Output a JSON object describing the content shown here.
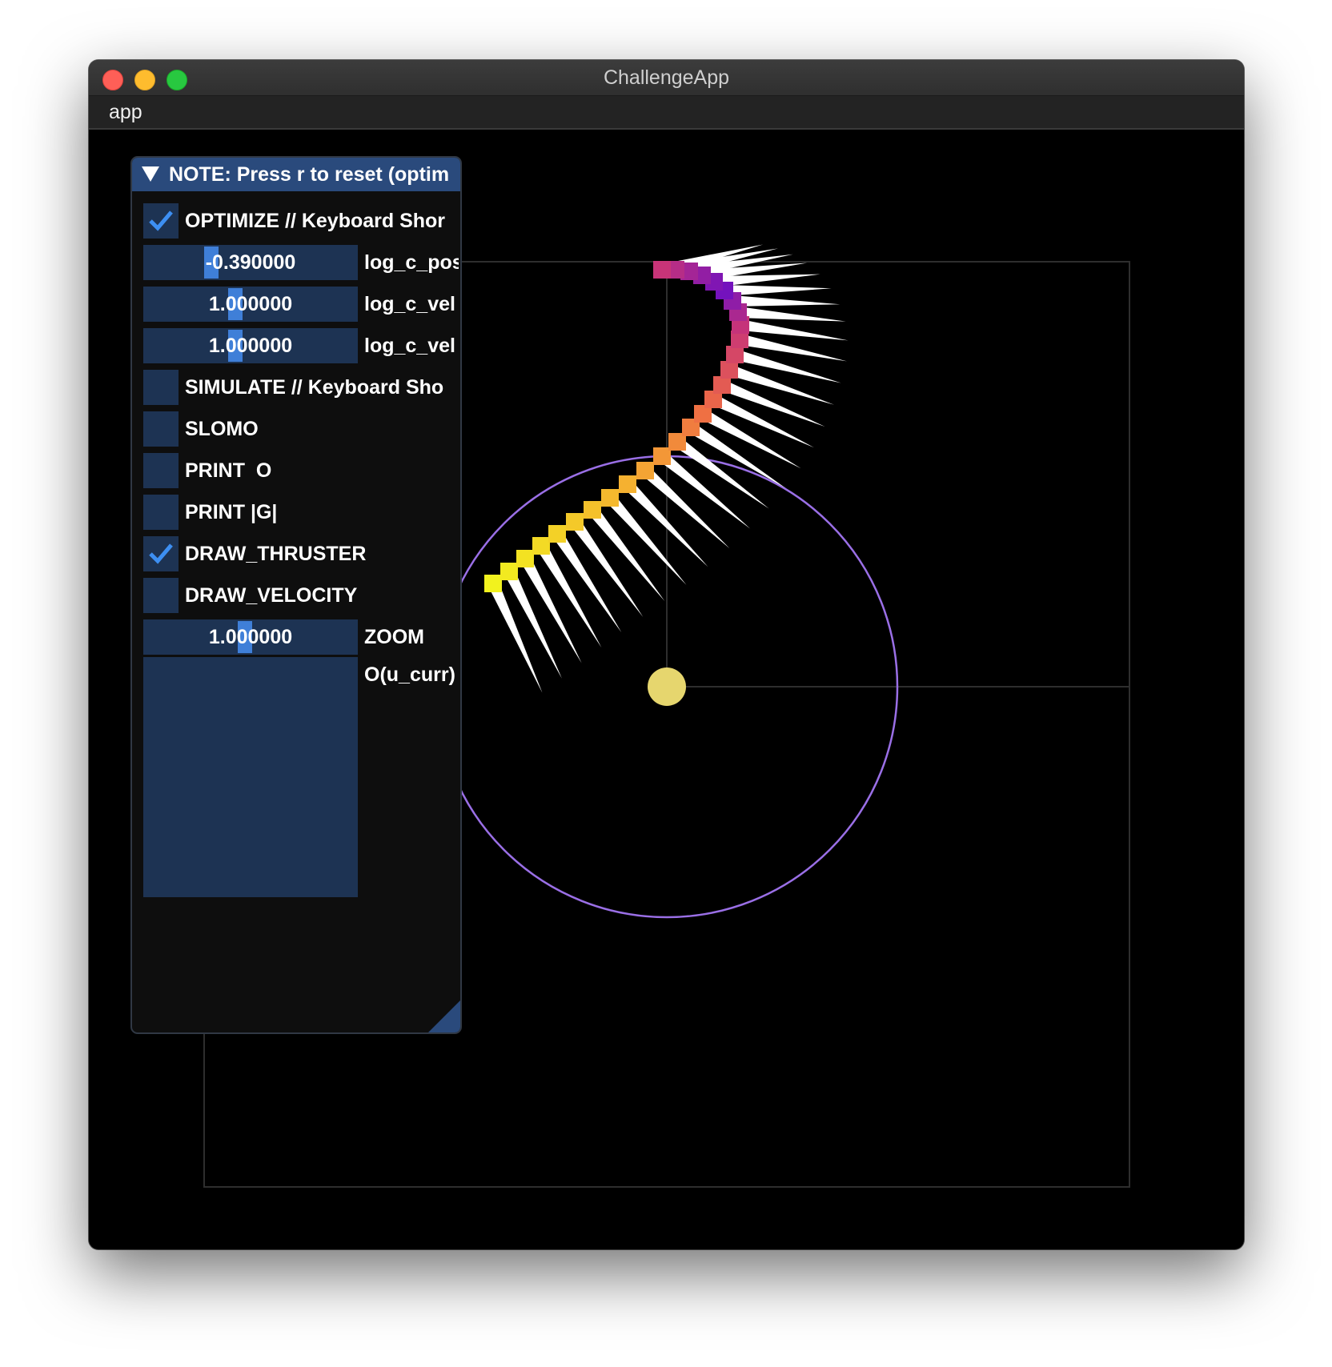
{
  "window": {
    "title": "ChallengeApp"
  },
  "menubar": {
    "items": [
      "app"
    ]
  },
  "panel": {
    "header": "NOTE: Press r to reset (optim",
    "optimize": {
      "label": "OPTIMIZE // Keyboard Shor",
      "checked": true
    },
    "log_c_pos": {
      "value": "-0.390000",
      "label": "log_c_pos"
    },
    "log_c_vel_1": {
      "value": "1.000000",
      "label": "log_c_vel"
    },
    "log_c_vel_2": {
      "value": "1.000000",
      "label": "log_c_vel"
    },
    "simulate": {
      "label": "SIMULATE // Keyboard Sho",
      "checked": false
    },
    "slomo": {
      "label": "SLOMO",
      "checked": false
    },
    "print_o": {
      "label": "PRINT  O",
      "checked": false
    },
    "print_g": {
      "label": "PRINT |G|",
      "checked": false
    },
    "draw_thruster": {
      "label": "DRAW_THRUSTER",
      "checked": true
    },
    "draw_velocity": {
      "label": "DRAW_VELOCITY",
      "checked": false
    },
    "zoom": {
      "value": "1.000000",
      "label": "ZOOM"
    },
    "o_plot": {
      "label": "O(u_curr)"
    }
  },
  "colors": {
    "checkmark": "#3d8ff2",
    "frame_bg": "#1d3353",
    "header_bg": "#2a4a7c",
    "orbit": "#9a6fe6",
    "planet": "#e6d66e",
    "thruster": "#ffffff",
    "trajectory_start": "#f0f020",
    "trajectory_mid": "#f07040",
    "trajectory_end": "#7a10c8"
  }
}
